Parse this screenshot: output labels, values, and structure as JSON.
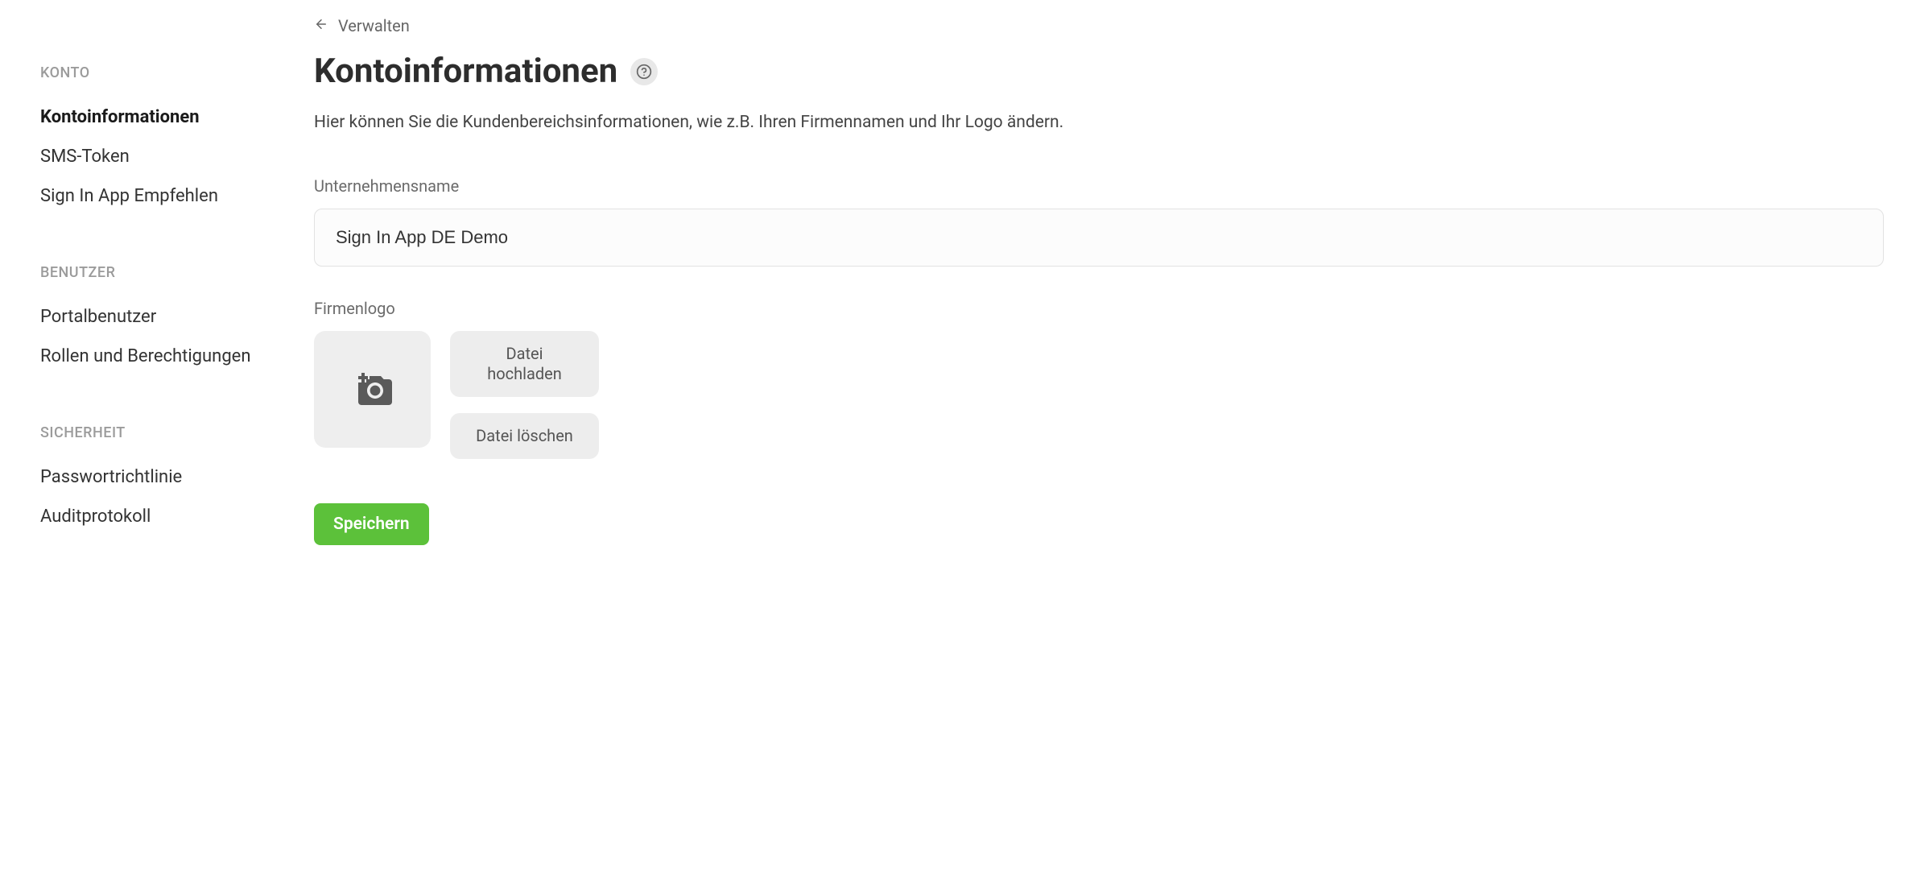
{
  "sidebar": {
    "sections": [
      {
        "header": "KONTO",
        "items": [
          {
            "label": "Kontoinformationen",
            "active": true
          },
          {
            "label": "SMS-Token",
            "active": false
          },
          {
            "label": "Sign In App Empfehlen",
            "active": false
          }
        ]
      },
      {
        "header": "BENUTZER",
        "items": [
          {
            "label": "Portalbenutzer",
            "active": false
          },
          {
            "label": "Rollen und Berechtigungen",
            "active": false
          }
        ]
      },
      {
        "header": "SICHERHEIT",
        "items": [
          {
            "label": "Passwortrichtlinie",
            "active": false
          },
          {
            "label": "Auditprotokoll",
            "active": false
          }
        ]
      }
    ]
  },
  "breadcrumb": {
    "label": "Verwalten"
  },
  "page": {
    "title": "Kontoinformationen",
    "description": "Hier können Sie die Kundenbereichsinformationen, wie z.B. Ihren Firmennamen und Ihr Logo ändern."
  },
  "form": {
    "company_name_label": "Unternehmensname",
    "company_name_value": "Sign In App DE Demo",
    "logo_label": "Firmenlogo",
    "upload_button": "Datei hochladen",
    "delete_button": "Datei löschen",
    "save_button": "Speichern"
  }
}
